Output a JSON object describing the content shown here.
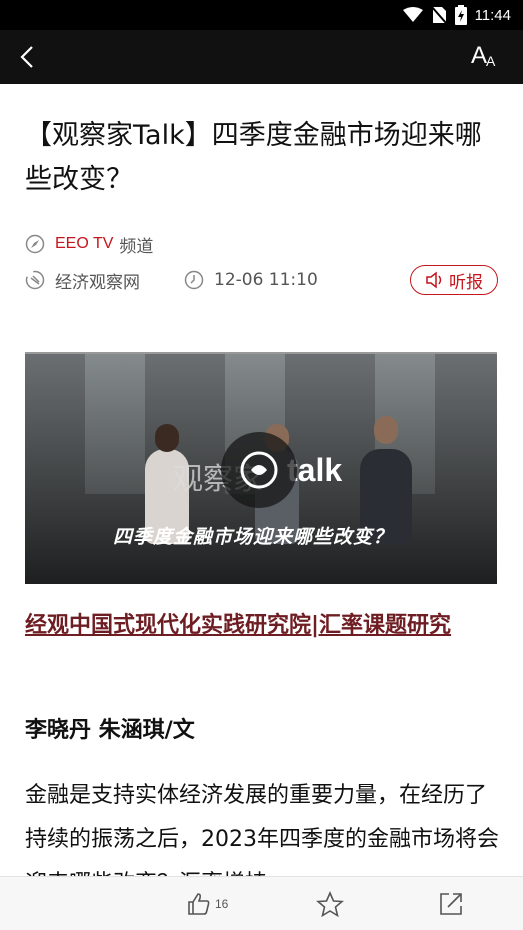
{
  "status_bar": {
    "time": "11:44"
  },
  "header": {
    "font_size_label_big": "A",
    "font_size_label_small": "A"
  },
  "article": {
    "title": "【观察家Talk】四季度金融市场迎来哪些改变？",
    "channel_name": "EEO TV",
    "channel_suffix": "频道",
    "source": "经济观察网",
    "datetime": "12-06 11:10",
    "listen_label": "听报",
    "video": {
      "caption": "四季度金融市场迎来哪些改变？",
      "logo_text": "观察家",
      "logo_talk": "talk"
    },
    "link_title": "经观中国式现代化实践研究院|汇率课题研究",
    "author": "李晓丹 朱涵琪/文",
    "body": "金融是支持实体经济发展的重要力量，在经历了持续的振荡之后，2023年四季度的金融市场将会迎来哪些改变？汇率增持"
  },
  "bottom_bar": {
    "like_count": "16"
  },
  "colors": {
    "accent": "#c4161c",
    "link": "#6e1d22",
    "appbar": "#111111"
  }
}
